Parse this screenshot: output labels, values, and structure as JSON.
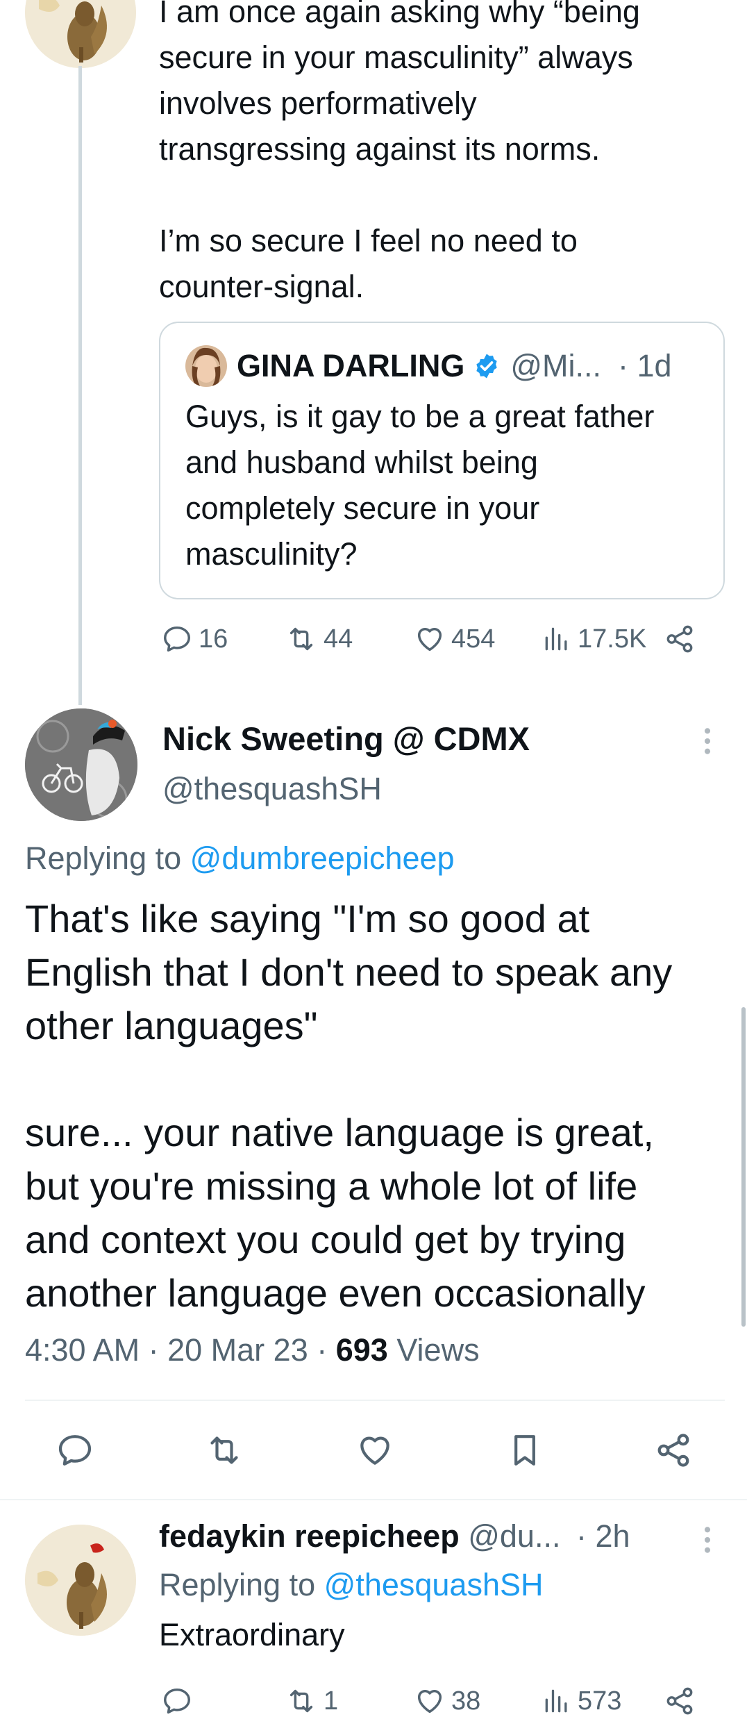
{
  "parent_tweet": {
    "text": "I am once again asking why “being\nsecure in your masculinity” always\ninvolves performatively\ntransgressing against its norms.\n\nI’m so secure I feel no need to\ncounter-signal.",
    "quote": {
      "name": "GINA DARLING",
      "handle": "@Mi...",
      "time": "· 1d",
      "text": "Guys, is it gay to be a great father\nand husband whilst being\ncompletely secure in your\nmasculinity?"
    },
    "stats": {
      "replies": "16",
      "retweets": "44",
      "likes": "454",
      "views": "17.5K"
    }
  },
  "main_tweet": {
    "name": "Nick Sweeting @ CDMX",
    "handle": "@thesquashSH",
    "replying_prefix": "Replying to ",
    "replying_to": "@dumbreepicheep",
    "text": "That's like saying \"I'm so good at\nEnglish that I don't need to speak any\nother languages\"\n\nsure... your native language is great,\nbut you're missing a whole lot of life\nand context you could get by trying\nanother language even occasionally",
    "time": "4:30 AM",
    "date": "20 Mar 23",
    "views_count": "693",
    "views_label": "Views",
    "sep": " · "
  },
  "reply_tweet": {
    "name": "fedaykin reepicheep",
    "handle": "@du...",
    "time": "· 2h",
    "replying_prefix": "Replying to ",
    "replying_to": "@thesquashSH",
    "text": "Extraordinary",
    "stats": {
      "replies": "",
      "retweets": "1",
      "likes": "38",
      "views": "573"
    }
  },
  "colors": {
    "text": "#0f1419",
    "muted": "#536471",
    "link": "#1d9bf0",
    "border": "#cfd9de",
    "divider": "#eff3f4"
  }
}
